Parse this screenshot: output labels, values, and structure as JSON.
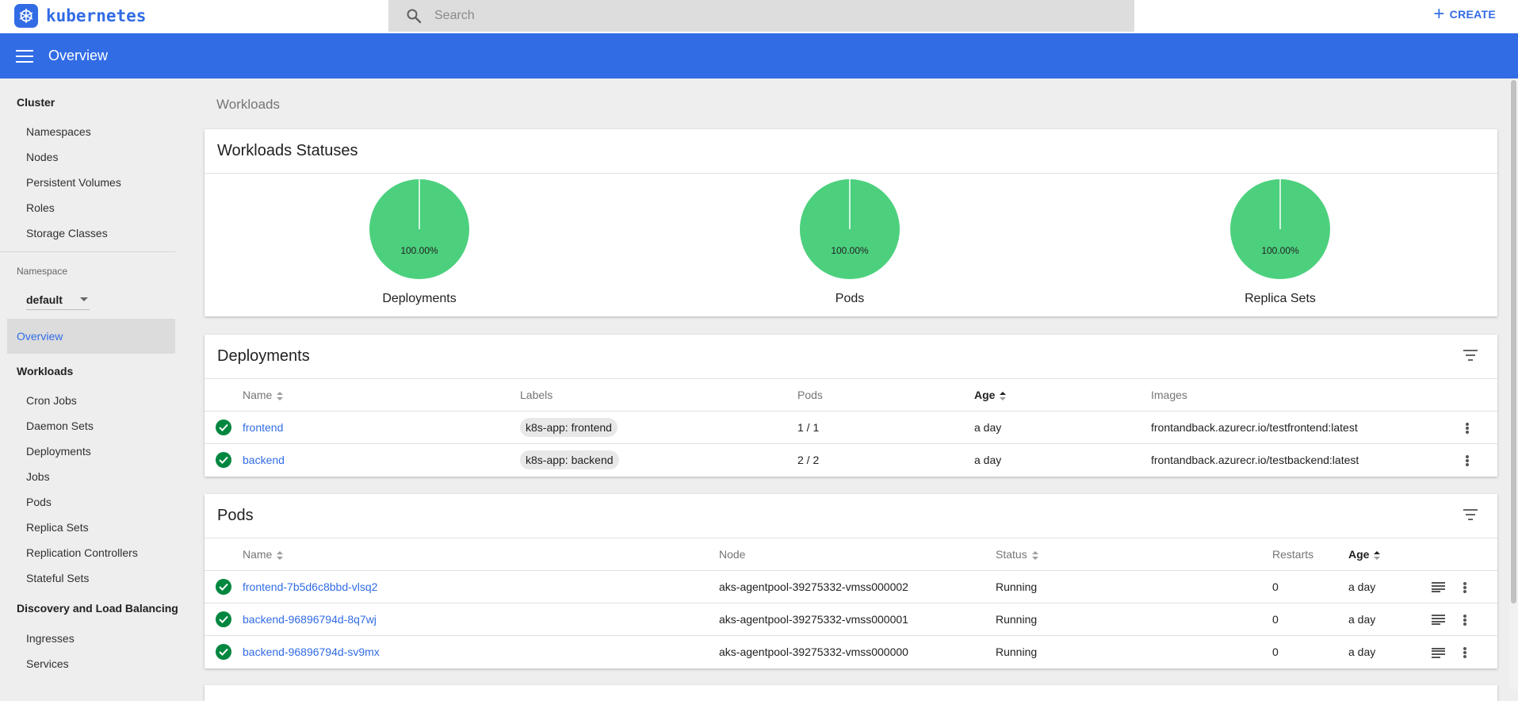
{
  "brand": {
    "name": "kubernetes"
  },
  "search": {
    "placeholder": "Search"
  },
  "header": {
    "create_label": "CREATE",
    "title": "Overview"
  },
  "sidebar": {
    "cluster_heading": "Cluster",
    "cluster_items": [
      "Namespaces",
      "Nodes",
      "Persistent Volumes",
      "Roles",
      "Storage Classes"
    ],
    "namespace_label": "Namespace",
    "namespace_value": "default",
    "active_item": "Overview",
    "workloads_heading": "Workloads",
    "workloads_items": [
      "Cron Jobs",
      "Daemon Sets",
      "Deployments",
      "Jobs",
      "Pods",
      "Replica Sets",
      "Replication Controllers",
      "Stateful Sets"
    ],
    "discovery_heading": "Discovery and Load Balancing",
    "discovery_items": [
      "Ingresses",
      "Services"
    ]
  },
  "breadcrumb": "Workloads",
  "statuses": {
    "title": "Workloads Statuses",
    "charts": [
      {
        "label": "Deployments",
        "percent_text": "100.00%",
        "running_fraction": 1.0
      },
      {
        "label": "Pods",
        "percent_text": "100.00%",
        "running_fraction": 1.0
      },
      {
        "label": "Replica Sets",
        "percent_text": "100.00%",
        "running_fraction": 1.0
      }
    ],
    "color_running": "#4cd07d"
  },
  "deployments": {
    "title": "Deployments",
    "columns": {
      "name": "Name",
      "labels": "Labels",
      "pods": "Pods",
      "age": "Age",
      "images": "Images"
    },
    "rows": [
      {
        "name": "frontend",
        "label": "k8s-app: frontend",
        "pods": "1 / 1",
        "age": "a day",
        "image": "frontandback.azurecr.io/testfrontend:latest"
      },
      {
        "name": "backend",
        "label": "k8s-app: backend",
        "pods": "2 / 2",
        "age": "a day",
        "image": "frontandback.azurecr.io/testbackend:latest"
      }
    ]
  },
  "pods": {
    "title": "Pods",
    "columns": {
      "name": "Name",
      "node": "Node",
      "status": "Status",
      "restarts": "Restarts",
      "age": "Age"
    },
    "rows": [
      {
        "name": "frontend-7b5d6c8bbd-vlsq2",
        "node": "aks-agentpool-39275332-vmss000002",
        "status": "Running",
        "restarts": "0",
        "age": "a day"
      },
      {
        "name": "backend-96896794d-8q7wj",
        "node": "aks-agentpool-39275332-vmss000001",
        "status": "Running",
        "restarts": "0",
        "age": "a day"
      },
      {
        "name": "backend-96896794d-sv9mx",
        "node": "aks-agentpool-39275332-vmss000000",
        "status": "Running",
        "restarts": "0",
        "age": "a day"
      }
    ]
  },
  "colors": {
    "accent": "#326ce5",
    "success": "#00873f"
  }
}
